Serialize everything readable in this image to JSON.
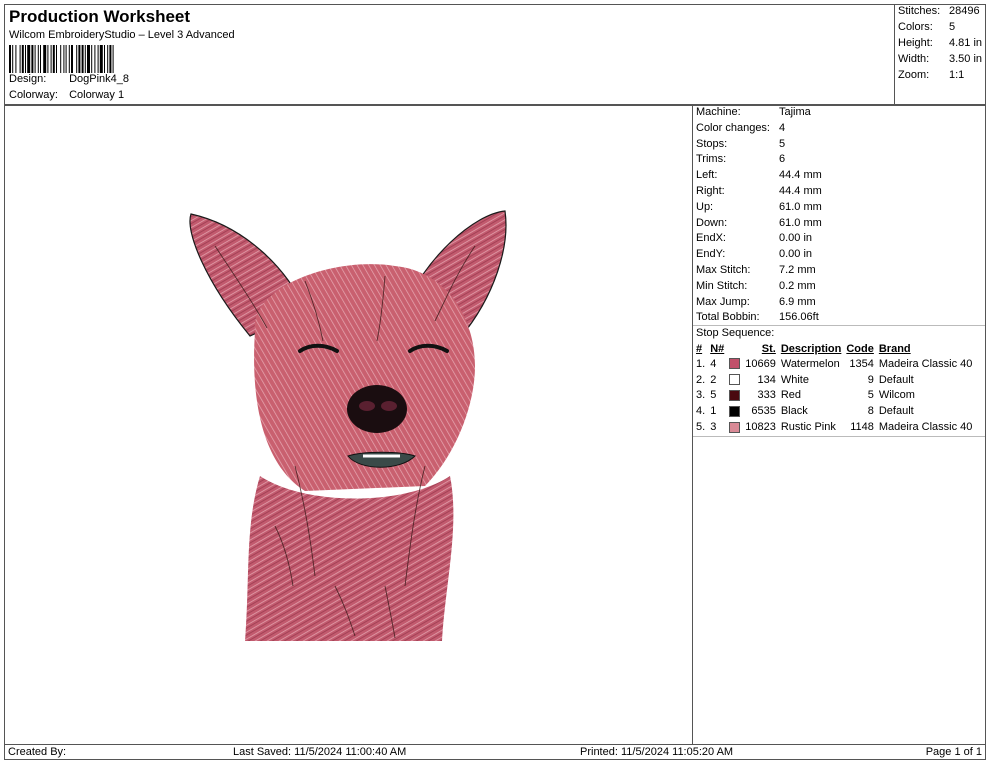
{
  "header": {
    "title": "Production Worksheet",
    "subtitle": "Wilcom EmbroideryStudio – Level 3 Advanced",
    "design_label": "Design:",
    "design_value": "DogPink4_8",
    "colorway_label": "Colorway:",
    "colorway_value": "Colorway 1"
  },
  "stats": [
    {
      "label": "Stitches:",
      "value": "28496"
    },
    {
      "label": "Colors:",
      "value": "5"
    },
    {
      "label": "Height:",
      "value": "4.81 in"
    },
    {
      "label": "Width:",
      "value": "3.50 in"
    },
    {
      "label": "Zoom:",
      "value": "1:1"
    }
  ],
  "machine_info": [
    {
      "label": "Machine:",
      "value": "Tajima"
    },
    {
      "label": "Color changes:",
      "value": "4"
    },
    {
      "label": "Stops:",
      "value": "5"
    },
    {
      "label": "Trims:",
      "value": "6"
    },
    {
      "label": "Left:",
      "value": "44.4 mm"
    },
    {
      "label": "Right:",
      "value": "44.4 mm"
    },
    {
      "label": "Up:",
      "value": "61.0 mm"
    },
    {
      "label": "Down:",
      "value": "61.0 mm"
    },
    {
      "label": "EndX:",
      "value": "0.00 in"
    },
    {
      "label": "EndY:",
      "value": "0.00 in"
    },
    {
      "label": "Max Stitch:",
      "value": "7.2 mm"
    },
    {
      "label": "Min Stitch:",
      "value": "0.2 mm"
    },
    {
      "label": "Max Jump:",
      "value": "6.9 mm"
    },
    {
      "label": "Total Bobbin:",
      "value": "156.06ft"
    }
  ],
  "stop_sequence": {
    "title": "Stop Sequence:",
    "headers": [
      "#",
      "N#",
      "St.",
      "Description",
      "Code",
      "Brand"
    ],
    "rows": [
      {
        "idx": "1.",
        "n": "4",
        "color": "#c0506a",
        "st": "10669",
        "desc": "Watermelon",
        "code": "1354",
        "brand": "Madeira Classic 40"
      },
      {
        "idx": "2.",
        "n": "2",
        "color": "#ffffff",
        "st": "134",
        "desc": "White",
        "code": "9",
        "brand": "Default"
      },
      {
        "idx": "3.",
        "n": "5",
        "color": "#4a0a10",
        "st": "333",
        "desc": "Red",
        "code": "5",
        "brand": "Wilcom"
      },
      {
        "idx": "4.",
        "n": "1",
        "color": "#000000",
        "st": "6535",
        "desc": "Black",
        "code": "8",
        "brand": "Default"
      },
      {
        "idx": "5.",
        "n": "3",
        "color": "#d98a96",
        "st": "10823",
        "desc": "Rustic Pink",
        "code": "1148",
        "brand": "Madeira Classic 40"
      }
    ]
  },
  "footer": {
    "created_by": "Created By:",
    "last_saved": "Last Saved: 11/5/2024 11:00:40 AM",
    "printed": "Printed: 11/5/2024 11:05:20 AM",
    "page": "Page 1 of 1"
  },
  "design_colors": {
    "main": "#c0506a",
    "light": "#d98a96",
    "dark": "#4a0a10",
    "black": "#000000"
  }
}
